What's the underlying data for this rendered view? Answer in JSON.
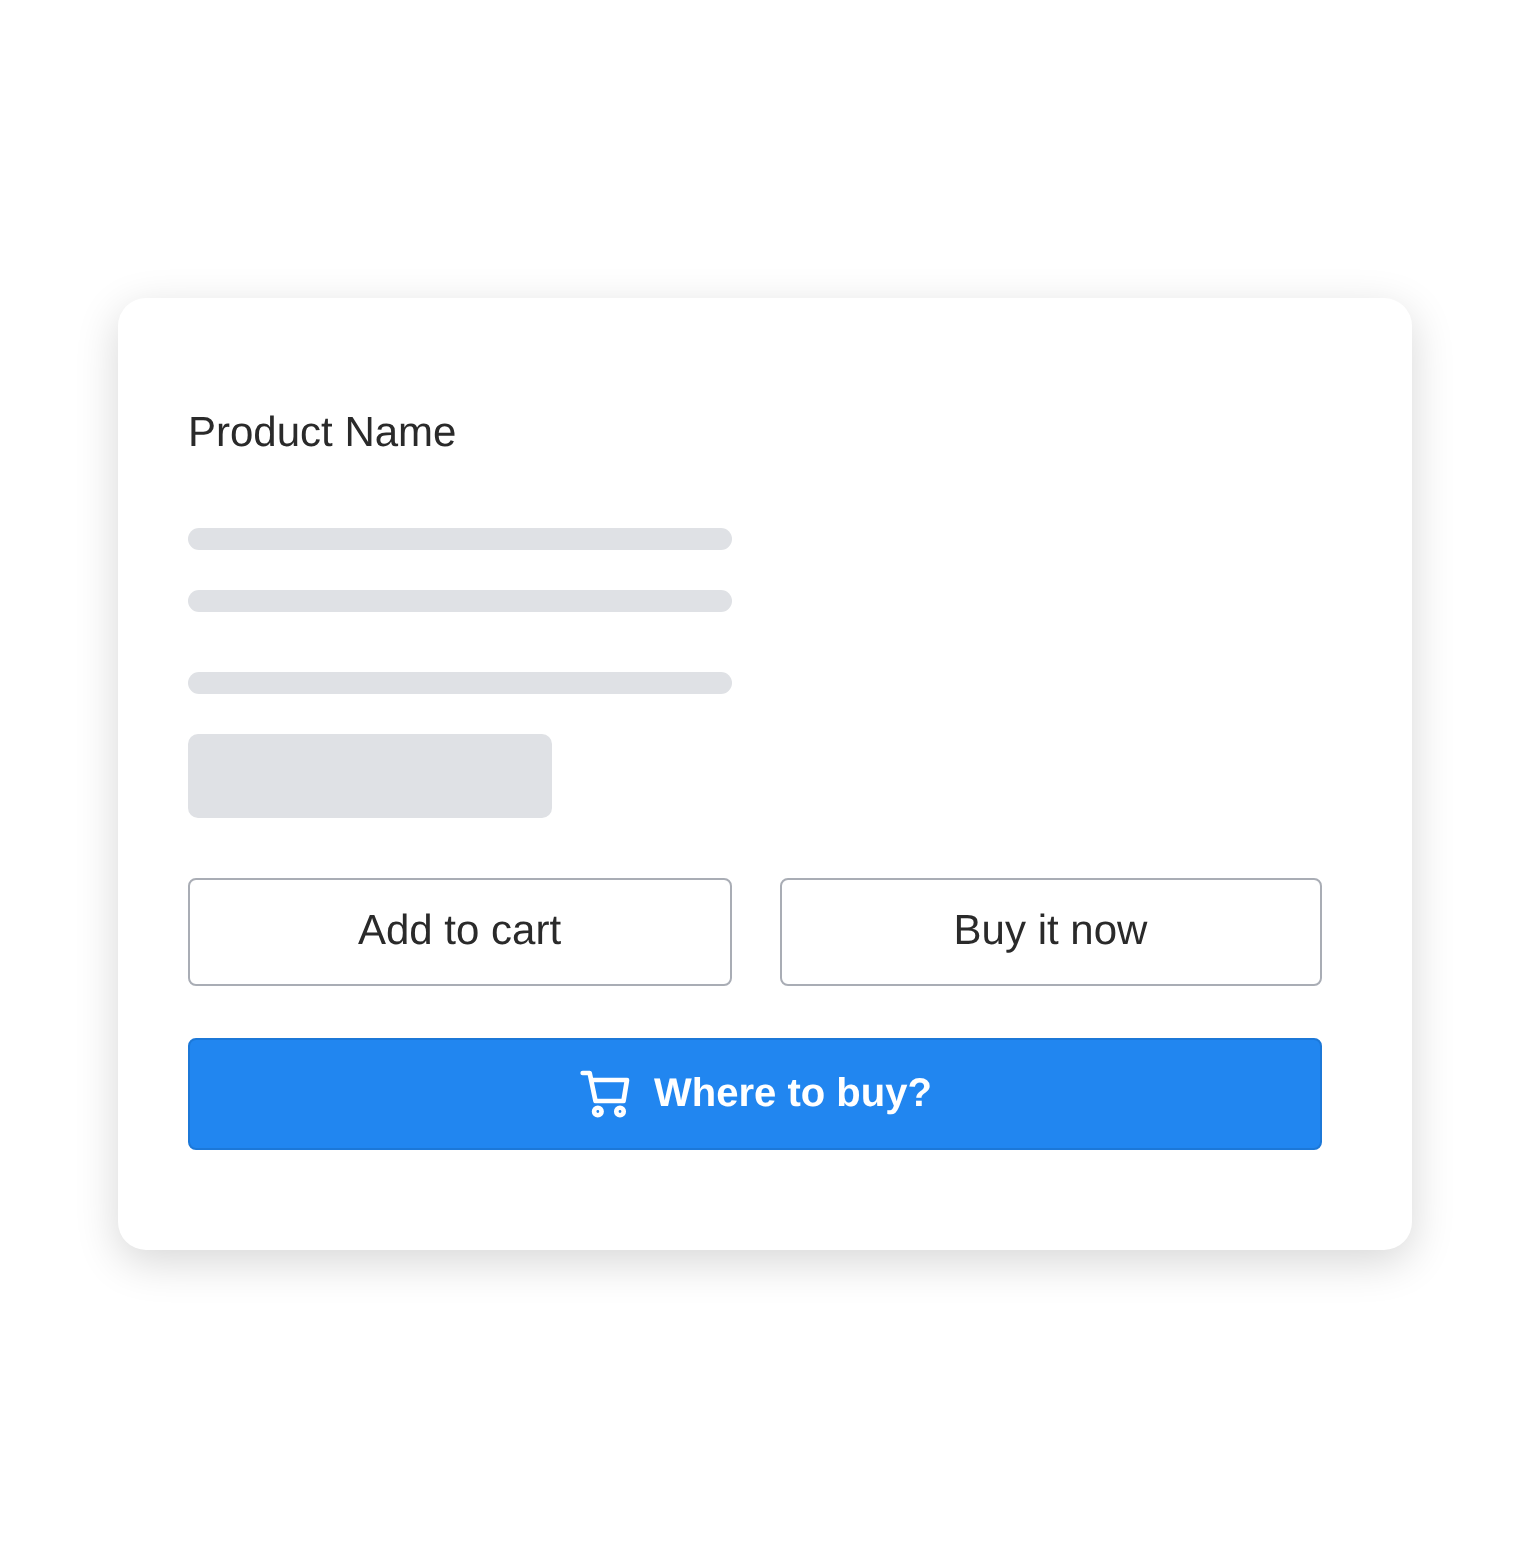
{
  "card": {
    "title": "Product Name",
    "skeleton": [
      {
        "kind": "line"
      },
      {
        "kind": "line"
      },
      {
        "kind": "line"
      },
      {
        "kind": "block"
      }
    ],
    "buttons": [
      {
        "label": "Add to cart",
        "kind": "outline"
      },
      {
        "label": "Buy it now",
        "kind": "outline"
      },
      {
        "label": "Where to buy?",
        "kind": "primary"
      }
    ]
  }
}
